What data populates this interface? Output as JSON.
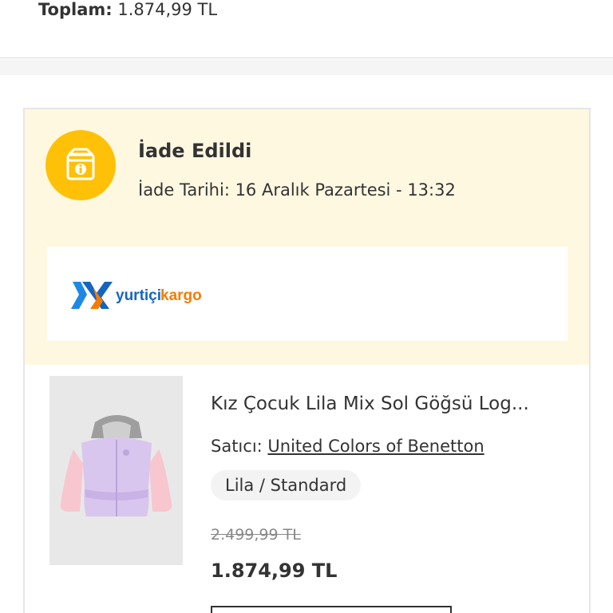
{
  "summary": {
    "total_label": "Toplam:",
    "total_value": "1.874,99 TL"
  },
  "status": {
    "title": "İade Edildi",
    "date_text": "İade Tarihi: 16 Aralık Pazartesi - 13:32",
    "icon": "box-info-icon",
    "background_color": "#fff8e1",
    "icon_color": "#ffc107"
  },
  "cargo": {
    "logo_text_part1": "yurtiçi",
    "logo_text_part2": "kargo",
    "brand_blue": "#1565c0",
    "brand_orange": "#f57c00"
  },
  "product": {
    "name": "Kız Çocuk Lila Mix Sol Göğsü Log...",
    "seller_label": "Satıcı:",
    "seller_name": "United Colors of Benetton",
    "variant": "Lila / Standard",
    "old_price": "2.499,99 TL",
    "price": "1.874,99 TL"
  }
}
